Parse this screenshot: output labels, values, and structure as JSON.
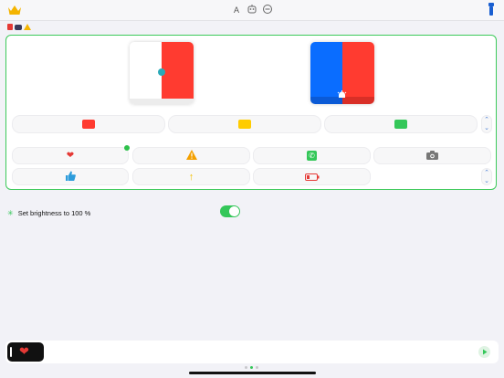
{
  "toolbar": {
    "crown_icon": "crown-icon",
    "text_size_label": "A",
    "emoji_icon": "robot-face-icon",
    "minus_icon": "minus-circle-icon",
    "flashlight_icon": "flashlight-icon"
  },
  "status_icons": [
    "fire-truck-icon",
    "police-car-icon",
    "warning-icon"
  ],
  "screens": [
    {
      "left_color": "#ffffff",
      "right_color": "#ff3b30",
      "badge": "dot"
    },
    {
      "left_color": "#0a6dff",
      "right_color": "#ff3b30",
      "badge": "siren"
    }
  ],
  "color_buttons": [
    "#ff3b30",
    "#ffcc00",
    "#34c759"
  ],
  "mode_buttons": [
    {
      "icon": "heart-icon",
      "glyph": "❤️"
    },
    {
      "icon": "warning-icon",
      "glyph": "⚠️"
    },
    {
      "icon": "phone-icon",
      "glyph": "📞"
    },
    {
      "icon": "camera-icon",
      "glyph": "📷"
    },
    {
      "icon": "thumbs-up-icon",
      "glyph": "👍"
    },
    {
      "icon": "arrow-up-icon",
      "glyph": "↑"
    },
    {
      "icon": "low-battery-icon",
      "glyph": ""
    }
  ],
  "settings": {
    "brightness_label": "Set brightness to 100 %",
    "brightness_enabled": true
  },
  "bottom": {
    "preview_glyph": "❤️",
    "play_icon": "play-icon"
  },
  "colors": {
    "accent_green": "#34c759",
    "panel_border": "#3cc95a"
  }
}
